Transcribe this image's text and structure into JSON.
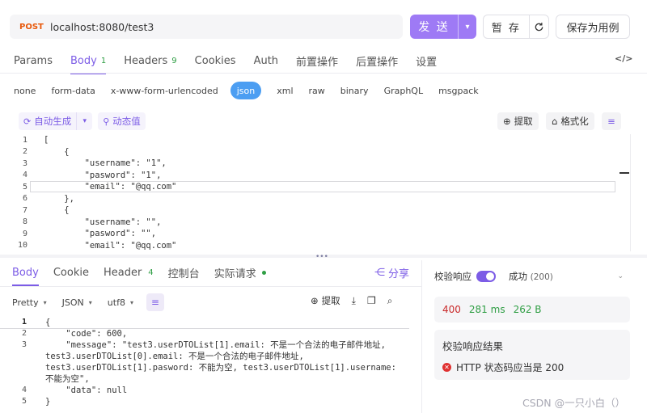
{
  "request": {
    "method": "POST",
    "url": "localhost:8080/test3",
    "send_label": "发 送",
    "save_label": "暂 存",
    "example_label": "保存为用例"
  },
  "req_tabs": [
    {
      "label": "Params"
    },
    {
      "label": "Body",
      "badge": "1",
      "active": true
    },
    {
      "label": "Headers",
      "badge": "9"
    },
    {
      "label": "Cookies"
    },
    {
      "label": "Auth"
    },
    {
      "label": "前置操作"
    },
    {
      "label": "后置操作"
    },
    {
      "label": "设置"
    }
  ],
  "body_types": [
    "none",
    "form-data",
    "x-www-form-urlencoded",
    "json",
    "xml",
    "raw",
    "binary",
    "GraphQL",
    "msgpack"
  ],
  "toolbar": {
    "auto_gen": "自动生成",
    "dynamic": "动态值",
    "extract": "提取",
    "format": "格式化"
  },
  "req_lines": [
    {
      "n": "1",
      "t": "["
    },
    {
      "n": "2",
      "t": "    {"
    },
    {
      "n": "3",
      "t": "        \"username\": \"1\","
    },
    {
      "n": "4",
      "t": "        \"pasword\": \"1\","
    },
    {
      "n": "5",
      "t": "        \"email\": \"@qq.com\""
    },
    {
      "n": "6",
      "t": "    },"
    },
    {
      "n": "7",
      "t": "    {"
    },
    {
      "n": "8",
      "t": "        \"username\": \"\","
    },
    {
      "n": "9",
      "t": "        \"pasword\": \"\","
    },
    {
      "n": "10",
      "t": "        \"email\": \"@qq.com\""
    }
  ],
  "res_tabs": [
    {
      "label": "Body",
      "active": true
    },
    {
      "label": "Cookie"
    },
    {
      "label": "Header",
      "badge": "4"
    },
    {
      "label": "控制台"
    },
    {
      "label": "实际请求"
    }
  ],
  "share_label": "分享",
  "res_tools": {
    "view": "Pretty",
    "format": "JSON",
    "encoding": "utf8",
    "extract": "提取"
  },
  "res_lines": [
    {
      "n": "1",
      "t": "{"
    },
    {
      "n": "2",
      "t": "    \"code\": 600,"
    },
    {
      "n": "3",
      "t": "    \"message\": \"test3.userDTOList[1].email: 不是一个合法的电子邮件地址, test3.userDTOList[0].email: 不是一个合法的电子邮件地址, test3.userDTOList[1].pasword: 不能为空, test3.userDTOList[1].username: 不能为空\","
    },
    {
      "n": "4",
      "t": "    \"data\": null"
    },
    {
      "n": "5",
      "t": "}"
    }
  ],
  "validation": {
    "label": "校验响应",
    "status": "成功",
    "status_code": "(200)",
    "metrics": {
      "code": "400",
      "time": "281 ms",
      "size": "262 B"
    },
    "result_title": "校验响应结果",
    "result_item": "HTTP 状态码应当是 200"
  },
  "watermark": "CSDN @一只小白（）"
}
